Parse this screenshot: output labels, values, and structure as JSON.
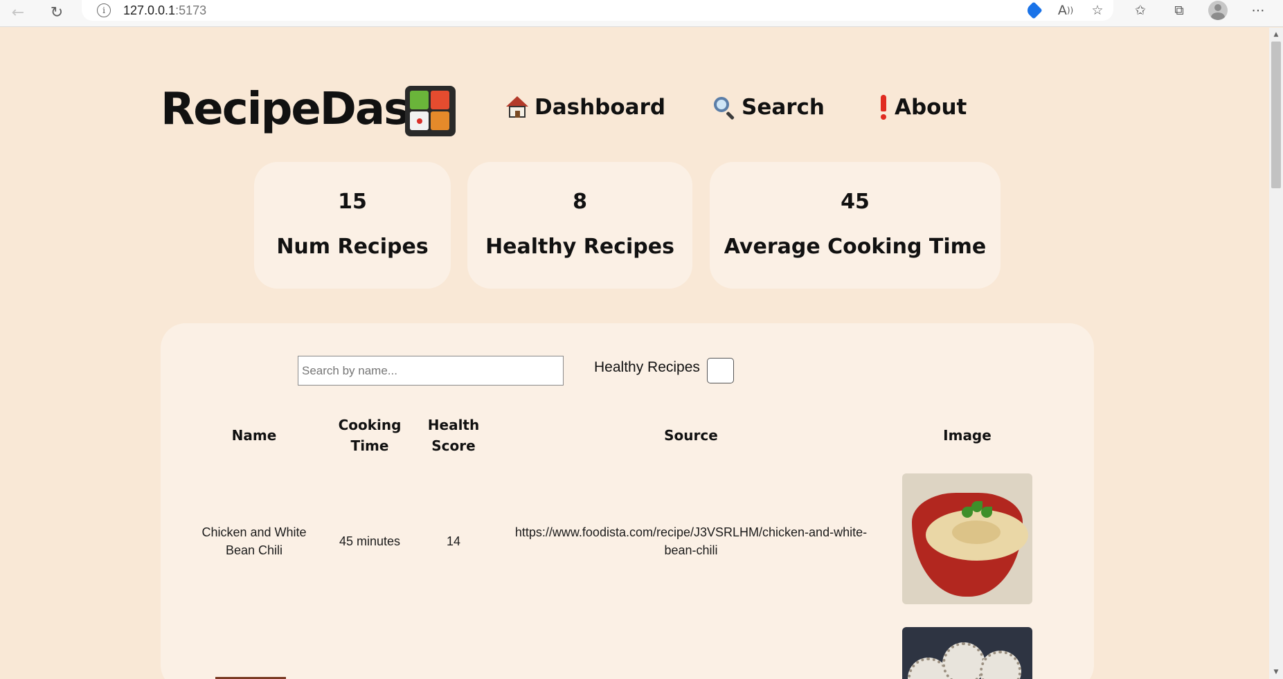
{
  "browser": {
    "url_host": "127.0.0.1",
    "url_port": ":5173",
    "icons": [
      "back-arrow-icon",
      "refresh-icon",
      "info-icon",
      "shopping-tag-icon",
      "read-aloud-icon",
      "add-favorite-icon",
      "favorites-icon",
      "collections-icon",
      "profile-icon",
      "more-menu-icon"
    ]
  },
  "header": {
    "app_title": "RecipeDash",
    "logo_icon": "bento-box-icon",
    "nav": [
      {
        "label": "Dashboard",
        "icon": "house-icon"
      },
      {
        "label": "Search",
        "icon": "magnifier-icon"
      },
      {
        "label": "About",
        "icon": "exclamation-icon"
      }
    ]
  },
  "stats": [
    {
      "value": "15",
      "label": "Num Recipes"
    },
    {
      "value": "8",
      "label": "Healthy Recipes"
    },
    {
      "value": "45",
      "label": "Average Cooking Time"
    }
  ],
  "filters": {
    "search_placeholder": "Search by name...",
    "search_value": "",
    "healthy_label": "Healthy Recipes",
    "healthy_checked": false
  },
  "table": {
    "headers": {
      "name": "Name",
      "cooking_time_1": "Cooking",
      "cooking_time_2": "Time",
      "health_score_1": "Health",
      "health_score_2": "Score",
      "source": "Source",
      "image": "Image"
    },
    "rows": [
      {
        "name_1": "Chicken and White",
        "name_2": "Bean Chili",
        "cooking_time": "45 minutes",
        "health_score": "14",
        "source_1": "https://www.foodista.com/recipe/J3VSRLHM/chicken-and-white-",
        "source_2": "bean-chili",
        "image_icon": "chili-bowl-photo"
      },
      {
        "image_icon": "snack-balls-photo"
      }
    ]
  },
  "colors": {
    "page_bg": "#f9e8d6",
    "card_bg": "#fbf0e5",
    "text": "#111111"
  }
}
